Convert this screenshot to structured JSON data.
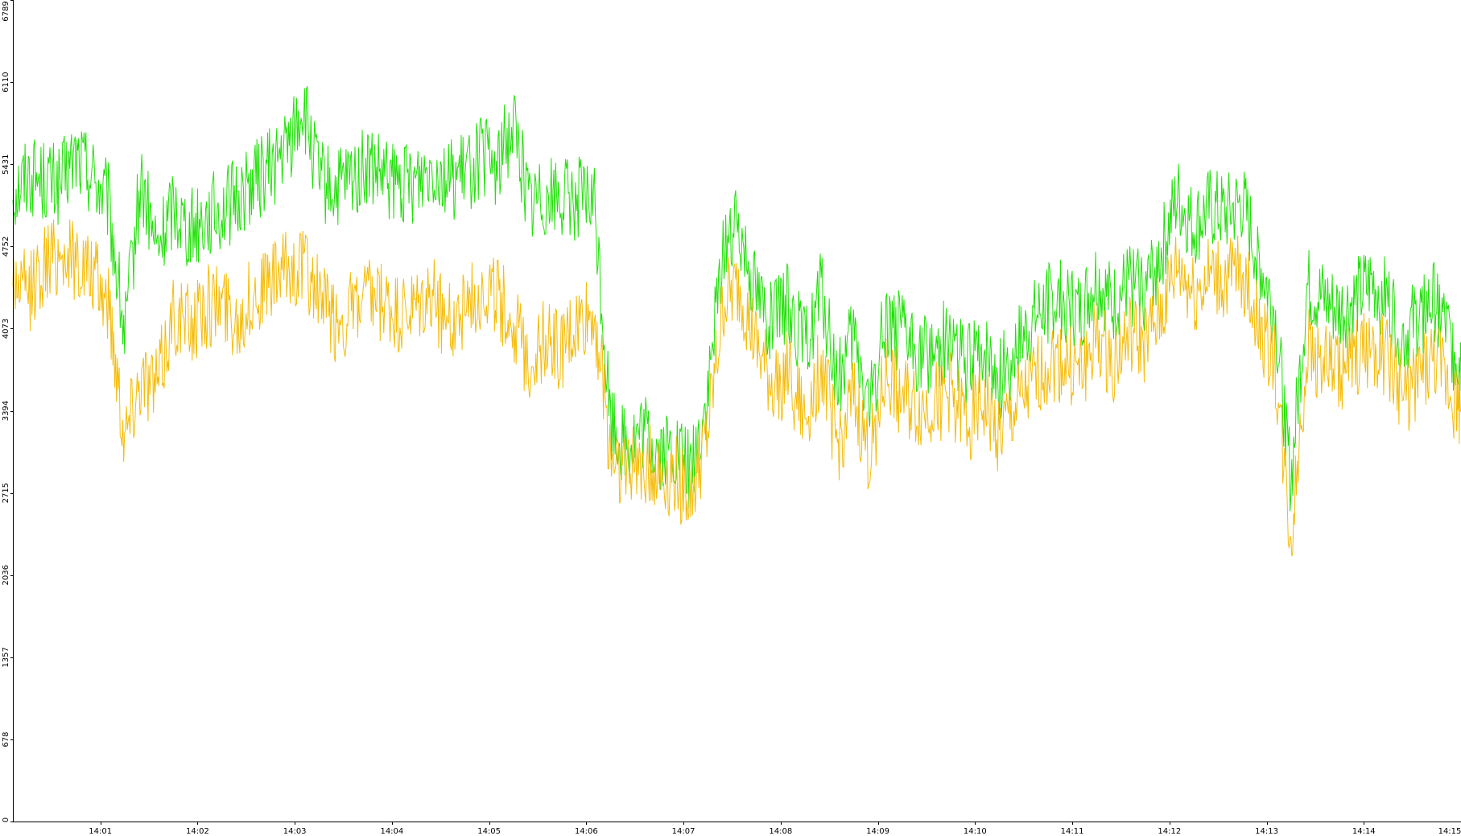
{
  "chart_data": {
    "type": "line",
    "title": "",
    "xlabel": "",
    "ylabel": "",
    "ylim": [
      0,
      6789
    ],
    "xlim": [
      "14:00:06",
      "14:15:00"
    ],
    "grid": false,
    "legend": "none",
    "y_ticks": [
      "0",
      "678",
      "1357",
      "2036",
      "2715",
      "3394",
      "4073",
      "4752",
      "5431",
      "6110",
      "6789"
    ],
    "y_tick_values": [
      0,
      678,
      1357,
      2036,
      2715,
      3394,
      4073,
      4752,
      5431,
      6110,
      6789
    ],
    "x_ticks": [
      "14:01",
      "14:02",
      "14:03",
      "14:04",
      "14:05",
      "14:06",
      "14:07",
      "14:08",
      "14:09",
      "14:10",
      "14:11",
      "14:12",
      "14:13",
      "14:14",
      "14:15"
    ],
    "x_tick_values": [
      "14:01:00",
      "14:02:00",
      "14:03:00",
      "14:04:00",
      "14:05:00",
      "14:06:00",
      "14:07:00",
      "14:08:00",
      "14:09:00",
      "14:10:00",
      "14:11:00",
      "14:12:00",
      "14:13:00",
      "14:14:00",
      "14:15:00"
    ],
    "series": [
      {
        "color": "#22e00a",
        "x": [
          "14:00:06",
          "14:00:15",
          "14:00:25",
          "14:00:35",
          "14:00:45",
          "14:00:55",
          "14:01:05",
          "14:01:15",
          "14:01:25",
          "14:01:35",
          "14:01:45",
          "14:01:55",
          "14:02:05",
          "14:02:15",
          "14:02:25",
          "14:02:35",
          "14:02:45",
          "14:02:55",
          "14:03:05",
          "14:03:15",
          "14:03:25",
          "14:03:35",
          "14:03:45",
          "14:03:55",
          "14:04:05",
          "14:04:15",
          "14:04:25",
          "14:04:35",
          "14:04:45",
          "14:04:55",
          "14:05:05",
          "14:05:15",
          "14:05:25",
          "14:05:35",
          "14:05:45",
          "14:05:55",
          "14:06:05",
          "14:06:15",
          "14:06:25",
          "14:06:35",
          "14:06:45",
          "14:06:55",
          "14:07:05",
          "14:07:15",
          "14:07:25",
          "14:07:35",
          "14:07:45",
          "14:07:55",
          "14:08:05",
          "14:08:15",
          "14:08:25",
          "14:08:35",
          "14:08:45",
          "14:08:55",
          "14:09:05",
          "14:09:15",
          "14:09:25",
          "14:09:35",
          "14:09:45",
          "14:09:55",
          "14:10:05",
          "14:10:15",
          "14:10:25",
          "14:10:35",
          "14:10:45",
          "14:10:55",
          "14:11:05",
          "14:11:15",
          "14:11:25",
          "14:11:35",
          "14:11:45",
          "14:11:55",
          "14:12:05",
          "14:12:15",
          "14:12:25",
          "14:12:35",
          "14:12:45",
          "14:12:55",
          "14:13:05",
          "14:13:15",
          "14:13:25",
          "14:13:35",
          "14:13:45",
          "14:13:55",
          "14:14:05",
          "14:14:15",
          "14:14:25",
          "14:14:35",
          "14:14:45",
          "14:14:55",
          "14:15:00"
        ],
        "values": [
          5200,
          5350,
          5300,
          5250,
          5500,
          5350,
          5100,
          4000,
          5300,
          4700,
          5100,
          4900,
          5000,
          5050,
          5150,
          5300,
          5400,
          5550,
          5900,
          5300,
          5200,
          5300,
          5400,
          5300,
          5250,
          5300,
          5450,
          5300,
          5350,
          5500,
          5400,
          5800,
          5100,
          5200,
          5150,
          5150,
          5100,
          3300,
          3100,
          3200,
          3050,
          3050,
          2900,
          3500,
          4800,
          4900,
          4400,
          4100,
          4300,
          3900,
          4400,
          3600,
          4000,
          3400,
          4200,
          4000,
          3850,
          3900,
          4000,
          3750,
          3900,
          3650,
          3900,
          4100,
          4300,
          4300,
          4200,
          4500,
          4250,
          4450,
          4400,
          4700,
          5150,
          4900,
          5050,
          5000,
          5100,
          4650,
          4200,
          2800,
          4400,
          4300,
          4200,
          4300,
          4450,
          4300,
          4000,
          4200,
          4300,
          3900,
          3800
        ]
      },
      {
        "color": "#f5bc0a",
        "x": [
          "14:00:06",
          "14:00:15",
          "14:00:25",
          "14:00:35",
          "14:00:45",
          "14:00:55",
          "14:01:05",
          "14:01:15",
          "14:01:25",
          "14:01:35",
          "14:01:45",
          "14:01:55",
          "14:02:05",
          "14:02:15",
          "14:02:25",
          "14:02:35",
          "14:02:45",
          "14:02:55",
          "14:03:05",
          "14:03:15",
          "14:03:25",
          "14:03:35",
          "14:03:45",
          "14:03:55",
          "14:04:05",
          "14:04:15",
          "14:04:25",
          "14:04:35",
          "14:04:45",
          "14:04:55",
          "14:05:05",
          "14:05:15",
          "14:05:25",
          "14:05:35",
          "14:05:45",
          "14:05:55",
          "14:06:05",
          "14:06:15",
          "14:06:25",
          "14:06:35",
          "14:06:45",
          "14:06:55",
          "14:07:05",
          "14:07:15",
          "14:07:25",
          "14:07:35",
          "14:07:45",
          "14:07:55",
          "14:08:05",
          "14:08:15",
          "14:08:25",
          "14:08:35",
          "14:08:45",
          "14:08:55",
          "14:09:05",
          "14:09:15",
          "14:09:25",
          "14:09:35",
          "14:09:45",
          "14:09:55",
          "14:10:05",
          "14:10:15",
          "14:10:25",
          "14:10:35",
          "14:10:45",
          "14:10:55",
          "14:11:05",
          "14:11:15",
          "14:11:25",
          "14:11:35",
          "14:11:45",
          "14:11:55",
          "14:12:05",
          "14:12:15",
          "14:12:25",
          "14:12:35",
          "14:12:45",
          "14:12:55",
          "14:13:05",
          "14:13:15",
          "14:13:25",
          "14:13:35",
          "14:13:45",
          "14:13:55",
          "14:14:05",
          "14:14:15",
          "14:14:25",
          "14:14:35",
          "14:14:45",
          "14:14:55",
          "14:15:00"
        ],
        "values": [
          4500,
          4350,
          4600,
          4700,
          4650,
          4500,
          4300,
          3200,
          3700,
          3600,
          4200,
          4100,
          4250,
          4300,
          4150,
          4350,
          4450,
          4550,
          4600,
          4350,
          4100,
          4200,
          4300,
          4250,
          4150,
          4200,
          4350,
          4100,
          4250,
          4400,
          4350,
          4100,
          3800,
          4000,
          3900,
          4100,
          4200,
          3050,
          2900,
          3000,
          2850,
          2850,
          2700,
          3200,
          4300,
          4400,
          3900,
          3600,
          3700,
          3300,
          3800,
          3100,
          3500,
          3000,
          3700,
          3500,
          3400,
          3450,
          3550,
          3300,
          3450,
          3200,
          3400,
          3600,
          3800,
          3800,
          3700,
          4000,
          3800,
          4000,
          3950,
          4200,
          4600,
          4350,
          4500,
          4450,
          4550,
          4100,
          3800,
          2300,
          3900,
          3800,
          3700,
          3800,
          3950,
          3800,
          3500,
          3700,
          3800,
          3500,
          3400
        ]
      }
    ]
  }
}
